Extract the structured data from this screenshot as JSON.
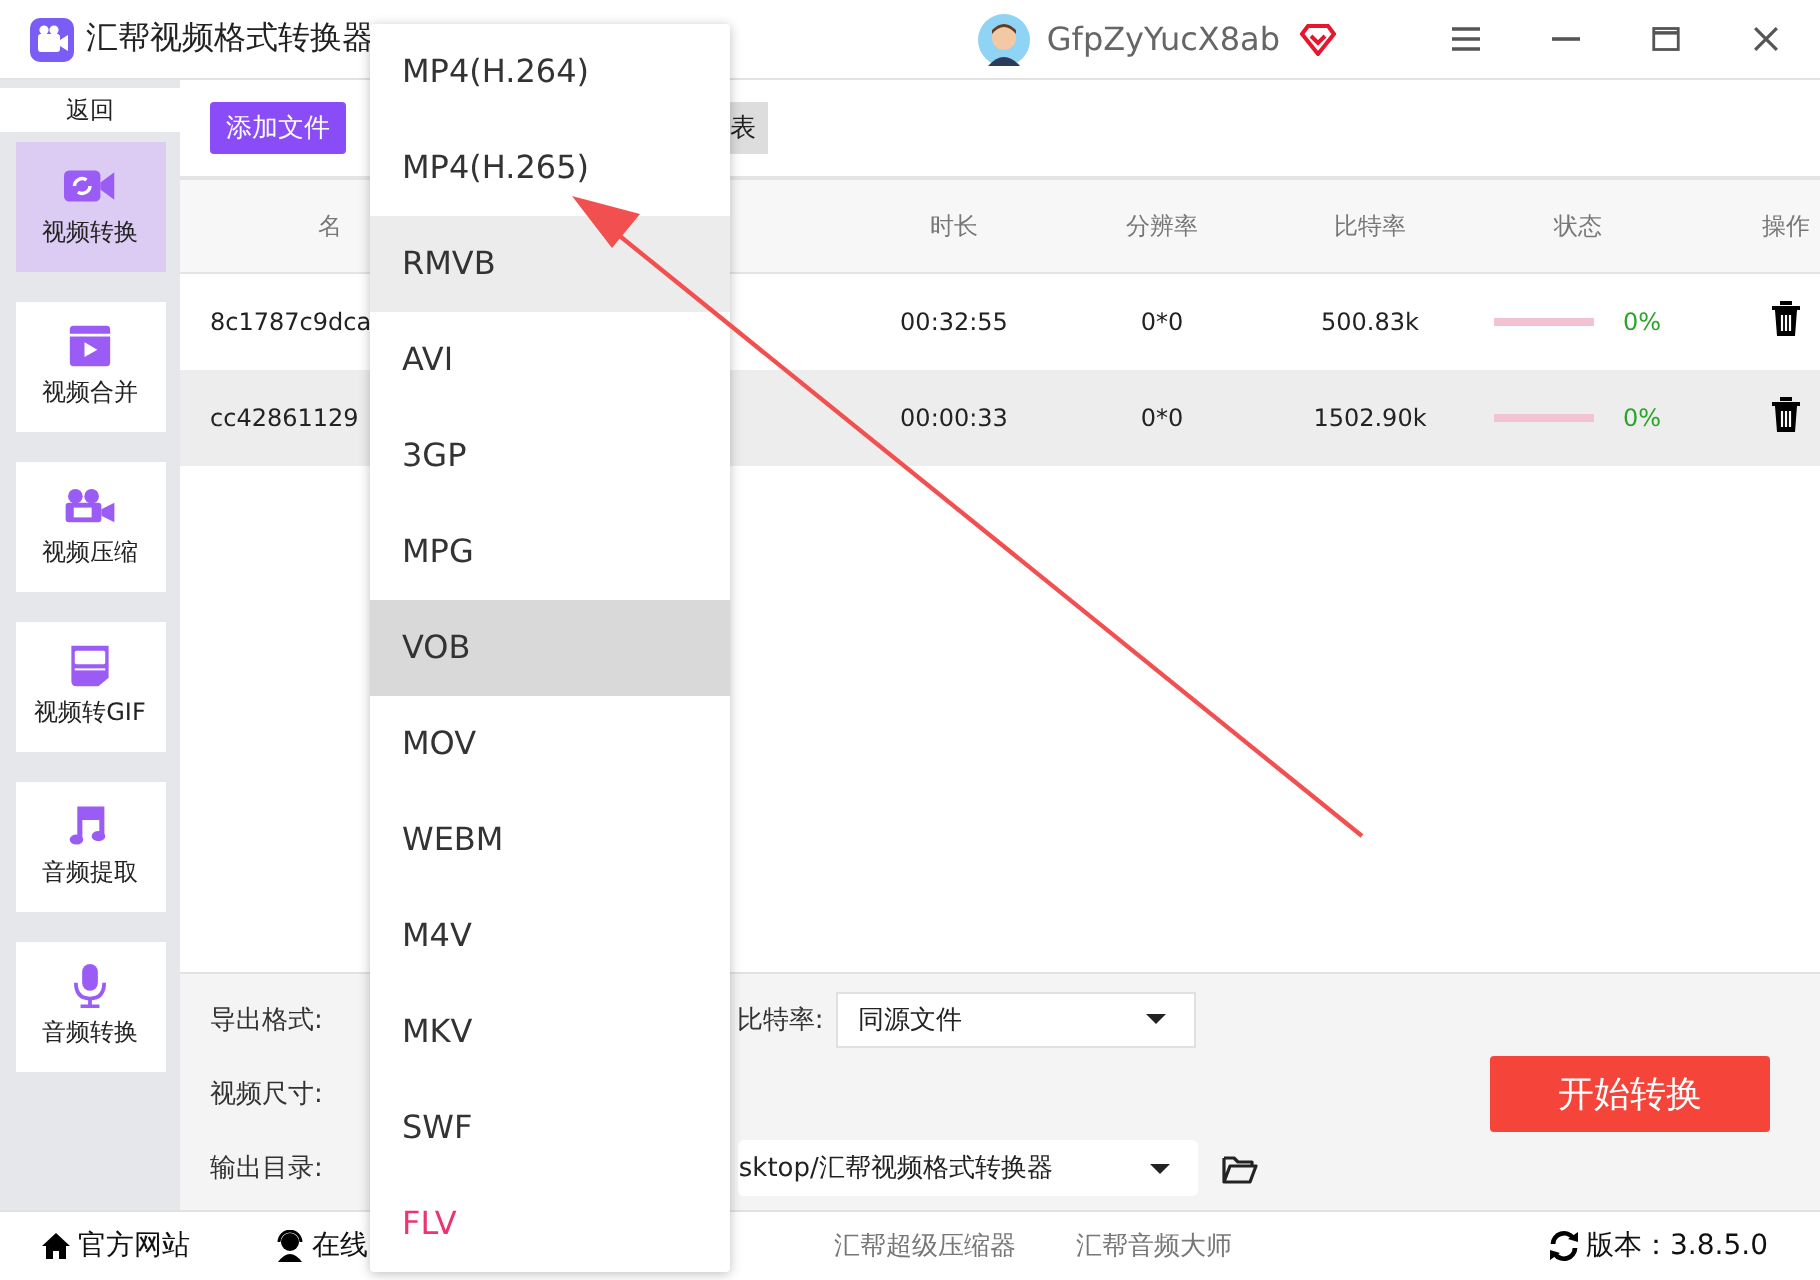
{
  "window": {
    "title": "汇帮视频格式转换器",
    "user": "GfpZyYucX8ab"
  },
  "sidebar": {
    "back": "返回",
    "items": [
      {
        "label": "视频转换",
        "selected": true
      },
      {
        "label": "视频合并",
        "selected": false
      },
      {
        "label": "视频压缩",
        "selected": false
      },
      {
        "label": "视频转GIF",
        "selected": false
      },
      {
        "label": "音频提取",
        "selected": false
      },
      {
        "label": "音频转换",
        "selected": false
      }
    ]
  },
  "toolbar": {
    "add_button": "添加文件",
    "clear_button": "表"
  },
  "table": {
    "columns": [
      "名",
      "时长",
      "分辨率",
      "比特率",
      "状态",
      "操作"
    ],
    "rows": [
      {
        "name": "8c1787c9dca",
        "duration": "00:32:55",
        "resolution": "0*0",
        "bitrate": "500.83k",
        "level": 0,
        "progress": "0%"
      },
      {
        "name": "cc42861129",
        "duration": "00:00:33",
        "resolution": "0*0",
        "bitrate": "1502.90k",
        "level": 0,
        "progress": "0%"
      }
    ]
  },
  "settings": {
    "format_label": "导出格式:",
    "bitrate_label": "比特率:",
    "bitrate_value": "同源文件",
    "size_label": "视频尺寸:",
    "output_label": "输出目录:",
    "output_value": "sktop/汇帮视频格式转换器",
    "start_button": "开始转换"
  },
  "dropdown": {
    "items": [
      {
        "label": "MP4(H.264)",
        "selected": false,
        "hovered": false,
        "current": false
      },
      {
        "label": "MP4(H.265)",
        "selected": false,
        "hovered": false,
        "current": false
      },
      {
        "label": "RMVB",
        "selected": false,
        "hovered": true,
        "current": false
      },
      {
        "label": "AVI",
        "selected": false,
        "hovered": false,
        "current": false
      },
      {
        "label": "3GP",
        "selected": false,
        "hovered": false,
        "current": false
      },
      {
        "label": "MPG",
        "selected": false,
        "hovered": false,
        "current": false
      },
      {
        "label": "VOB",
        "selected": true,
        "hovered": false,
        "current": false
      },
      {
        "label": "MOV",
        "selected": false,
        "hovered": false,
        "current": false
      },
      {
        "label": "WEBM",
        "selected": false,
        "hovered": false,
        "current": false
      },
      {
        "label": "M4V",
        "selected": false,
        "hovered": false,
        "current": false
      },
      {
        "label": "MKV",
        "selected": false,
        "hovered": false,
        "current": false
      },
      {
        "label": "SWF",
        "selected": false,
        "hovered": false,
        "current": false
      },
      {
        "label": "FLV",
        "selected": false,
        "hovered": false,
        "current": true
      }
    ]
  },
  "status_bar": {
    "website": "官方网站",
    "support": "在线",
    "links": [
      "汇帮超级压缩器",
      "汇帮音频大师"
    ],
    "version": "版本：3.8.5.0"
  }
}
